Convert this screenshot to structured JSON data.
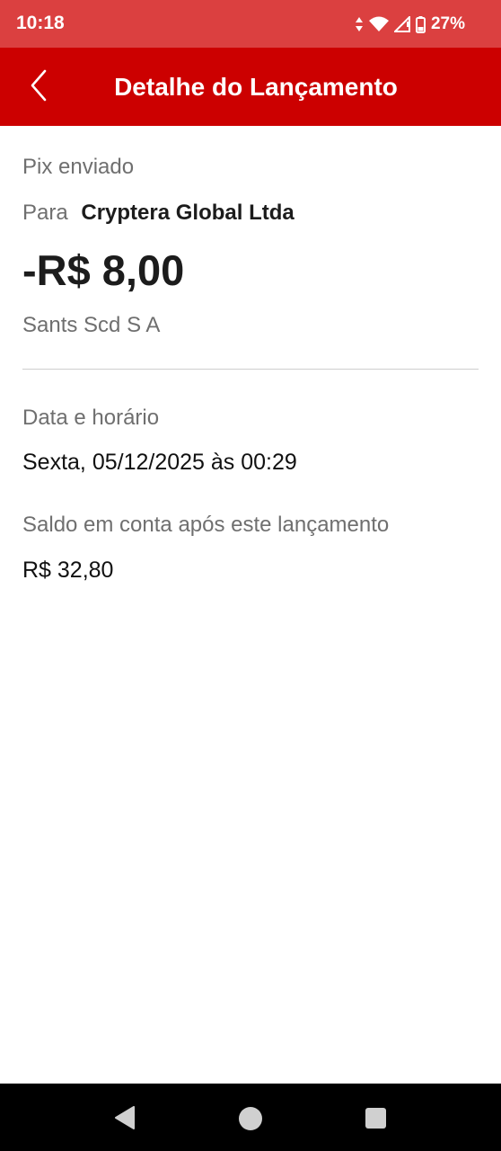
{
  "status_bar": {
    "time": "10:18",
    "battery": "27%",
    "icons": [
      "data-arrows-icon",
      "wifi-icon",
      "signal-icon",
      "battery-icon"
    ]
  },
  "header": {
    "title": "Detalhe do Lançamento",
    "back_icon": "chevron-left-icon",
    "background": "#cc0000"
  },
  "transaction": {
    "type": "Pix enviado",
    "recipient_prefix": "Para",
    "recipient_name": "Cryptera Global Ltda",
    "amount": "-R$ 8,00",
    "institution": "Sants Scd S A"
  },
  "details": {
    "date_label": "Data e horário",
    "date_value": "Sexta, 05/12/2025 às 00:29",
    "balance_label": "Saldo em conta após este lançamento",
    "balance_value": "R$ 32,80"
  },
  "nav_bar": {
    "buttons": [
      "back-triangle-icon",
      "home-circle-icon",
      "recents-square-icon"
    ]
  }
}
